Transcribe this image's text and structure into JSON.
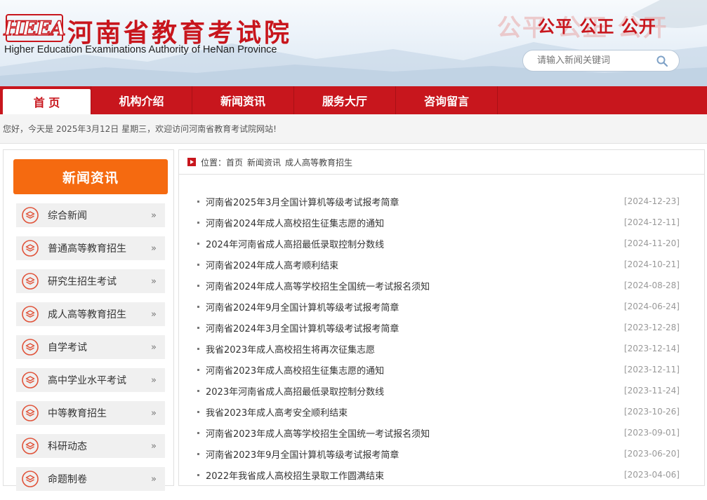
{
  "header": {
    "logo_text": "HEEA",
    "title_cn": "河南省教育考试院",
    "title_en": "Higher Education Examinations Authority of HeNan Province",
    "slogan": "公平 公正 公开",
    "slogan_ghost": "公平 公正 公开"
  },
  "search": {
    "placeholder": "请输入新闻关键词",
    "icon": "search-icon"
  },
  "nav": {
    "items": [
      {
        "label": "首 页",
        "active": true
      },
      {
        "label": "机构介绍"
      },
      {
        "label": "新闻资讯"
      },
      {
        "label": "服务大厅"
      },
      {
        "label": "咨询留言"
      }
    ]
  },
  "welcome": {
    "text": "您好，今天是 2025年3月12日 星期三，欢迎访问河南省教育考试院网站!"
  },
  "sidebar": {
    "heading": "新闻资讯",
    "arrow": "»",
    "items": [
      {
        "label": "综合新闻"
      },
      {
        "label": "普通高等教育招生"
      },
      {
        "label": "研究生招生考试"
      },
      {
        "label": "成人高等教育招生"
      },
      {
        "label": "自学考试"
      },
      {
        "label": "高中学业水平考试"
      },
      {
        "label": "中等教育招生"
      },
      {
        "label": "科研动态"
      },
      {
        "label": "命题制卷"
      }
    ]
  },
  "breadcrumb": {
    "prefix": "位置：",
    "items": [
      "首页",
      "新闻资讯",
      "成人高等教育招生"
    ]
  },
  "news": [
    {
      "title": "河南省2025年3月全国计算机等级考试报考简章",
      "date": "[2024-12-23]"
    },
    {
      "title": "河南省2024年成人高校招生征集志愿的通知",
      "date": "[2024-12-11]"
    },
    {
      "title": "2024年河南省成人高招最低录取控制分数线",
      "date": "[2024-11-20]"
    },
    {
      "title": "河南省2024年成人高考顺利结束",
      "date": "[2024-10-21]"
    },
    {
      "title": "河南省2024年成人高等学校招生全国统一考试报名须知",
      "date": "[2024-08-28]"
    },
    {
      "title": "河南省2024年9月全国计算机等级考试报考简章",
      "date": "[2024-06-24]"
    },
    {
      "title": "河南省2024年3月全国计算机等级考试报考简章",
      "date": "[2023-12-28]"
    },
    {
      "title": "我省2023年成人高校招生将再次征集志愿",
      "date": "[2023-12-14]"
    },
    {
      "title": "河南省2023年成人高校招生征集志愿的通知",
      "date": "[2023-12-11]"
    },
    {
      "title": "2023年河南省成人高招最低录取控制分数线",
      "date": "[2023-11-24]"
    },
    {
      "title": "我省2023年成人高考安全顺利结束",
      "date": "[2023-10-26]"
    },
    {
      "title": "河南省2023年成人高等学校招生全国统一考试报名须知",
      "date": "[2023-09-01]"
    },
    {
      "title": "河南省2023年9月全国计算机等级考试报考简章",
      "date": "[2023-06-20]"
    },
    {
      "title": "2022年我省成人高校招生录取工作圆满结束",
      "date": "[2023-04-06]"
    }
  ],
  "colors": {
    "brand_red": "#c8161d",
    "accent_orange": "#f56a10"
  }
}
